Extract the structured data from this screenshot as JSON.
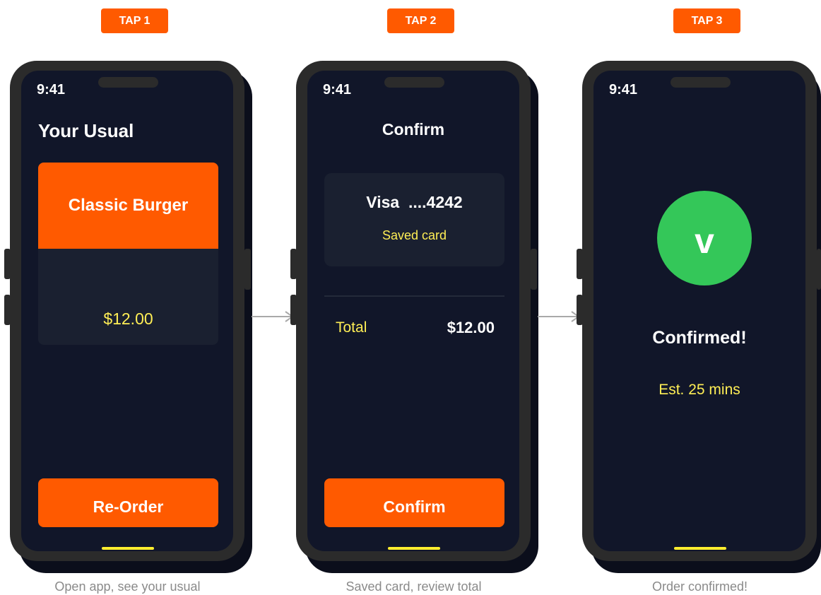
{
  "taps": [
    "TAP 1",
    "TAP 2",
    "TAP 3"
  ],
  "status_time": "9:41",
  "screen1": {
    "title": "Your Usual",
    "item_name": "Classic Burger",
    "item_price": "$12.00",
    "reorder_label": "Re-Order",
    "caption": "Open app, see your usual"
  },
  "screen2": {
    "title": "Confirm",
    "card_number": "Visa  ....4242",
    "card_sub": "Saved card",
    "total_label": "Total",
    "total_value": "$12.00",
    "confirm_label": "Confirm",
    "caption": "Saved card, review total"
  },
  "screen3": {
    "check_glyph": "v",
    "title": "Confirmed!",
    "eta": "Est. 25 mins",
    "caption": "Order confirmed!"
  },
  "colors": {
    "accent": "#ff5a00",
    "screen_bg": "#111629",
    "highlight": "#ffee55",
    "success": "#34c759"
  },
  "icons": [
    "arrow-right-icon",
    "check-icon"
  ]
}
